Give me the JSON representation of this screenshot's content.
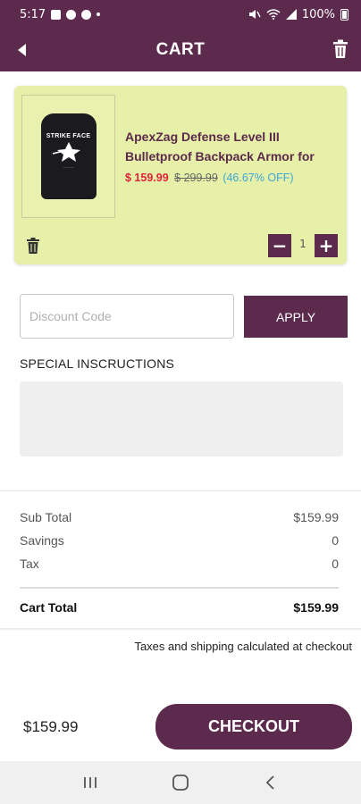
{
  "status_bar": {
    "time": "5:17",
    "battery": "100%"
  },
  "header": {
    "title": "CART"
  },
  "cart_item": {
    "image_text": "STRIKE FACE",
    "name": "ApexZag Defense Level III Bulletproof Backpack Armor for",
    "sale_price": "$ 159.99",
    "original_price": "$ 299.99",
    "discount": "(46.67% OFF)",
    "quantity": "1"
  },
  "discount": {
    "placeholder": "Discount Code",
    "apply_label": "APPLY"
  },
  "special_instructions": {
    "label": "SPECIAL INSCRUCTIONS"
  },
  "summary": {
    "rows": [
      {
        "label": "Sub Total",
        "value": "$159.99"
      },
      {
        "label": "Savings",
        "value": "0"
      },
      {
        "label": "Tax",
        "value": "0"
      }
    ],
    "total_label": "Cart Total",
    "total_value": "$159.99"
  },
  "note": "Taxes and shipping calculated at checkout",
  "footer": {
    "total": "$159.99",
    "checkout_label": "CHECKOUT"
  },
  "colors": {
    "brand": "#5c2a4c",
    "card_bg": "#e6f0a8",
    "sale_red": "#e0223b",
    "discount_blue": "#3ea7d6"
  },
  "icons": {
    "back": "back-arrow-icon",
    "clear_cart": "trash-icon",
    "remove_item": "trash-icon",
    "minus": "minus-icon",
    "plus": "plus-icon",
    "nav_recents": "recents-icon",
    "nav_home": "home-icon",
    "nav_back": "nav-back-icon"
  }
}
